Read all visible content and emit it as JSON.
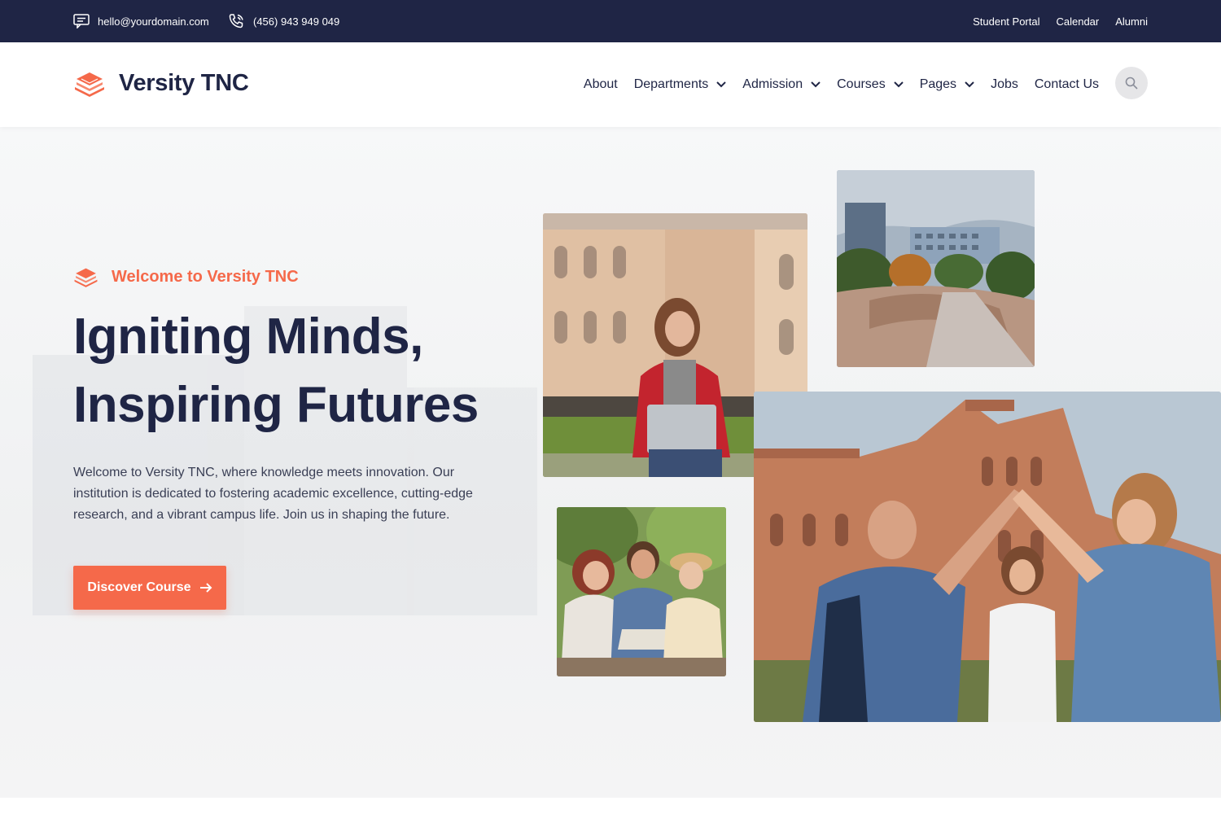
{
  "topbar": {
    "email": "hello@yourdomain.com",
    "phone": "(456) 943 949 049",
    "links": [
      "Student Portal",
      "Calendar",
      "Alumni"
    ]
  },
  "header": {
    "brand": "Versity TNC",
    "nav": [
      {
        "label": "About",
        "dropdown": false
      },
      {
        "label": "Departments",
        "dropdown": true
      },
      {
        "label": "Admission",
        "dropdown": true
      },
      {
        "label": "Courses",
        "dropdown": true
      },
      {
        "label": "Pages",
        "dropdown": true
      },
      {
        "label": "Jobs",
        "dropdown": false
      },
      {
        "label": "Contact Us",
        "dropdown": false
      }
    ],
    "search_icon": "search-icon"
  },
  "hero": {
    "tagline": "Welcome to Versity TNC",
    "headline_line1": "Igniting Minds,",
    "headline_line2": "Inspiring Futures",
    "description": "Welcome to Versity TNC, where knowledge meets innovation. Our institution is dedicated to fostering academic excellence, cutting-edge research, and a vibrant campus life. Join us in shaping the future.",
    "cta_label": "Discover Course"
  },
  "colors": {
    "navy": "#1f2545",
    "accent": "#f5694a",
    "search_bg": "#e6e6e8"
  }
}
